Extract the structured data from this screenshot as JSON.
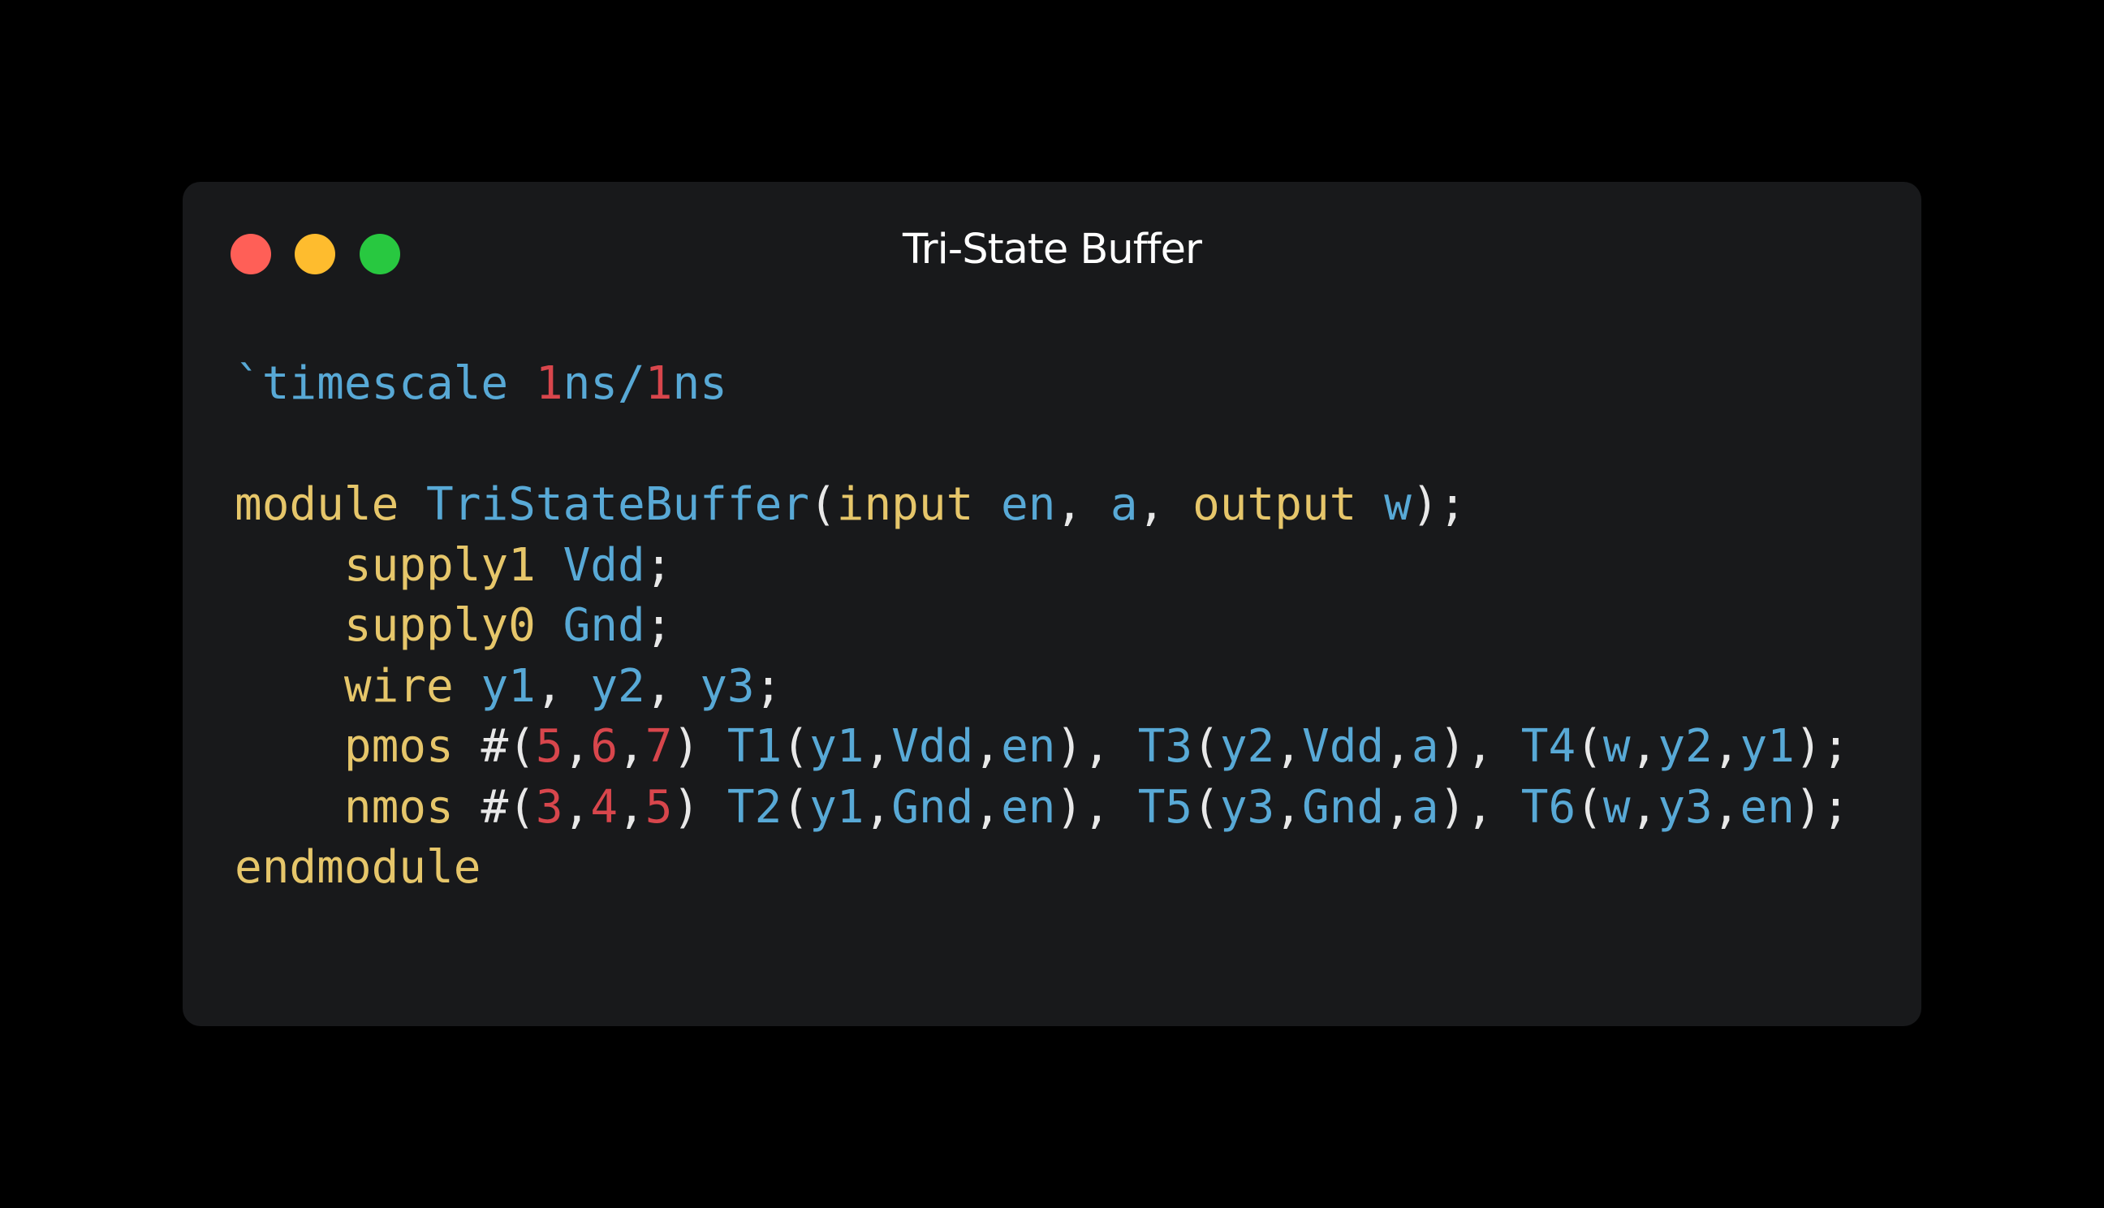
{
  "window": {
    "title": "Tri-State Buffer",
    "buttons": {
      "close_color": "#ff5f57",
      "minimize_color": "#febc2e",
      "maximize_color": "#28c840"
    }
  },
  "colors": {
    "keyword": "#e6c66a",
    "identifier": "#58a9d6",
    "number": "#d8464c",
    "punctuation": "#e8e8e8",
    "background": "#18191b"
  },
  "code": {
    "lines": [
      [
        {
          "t": "`timescale ",
          "c": "id"
        },
        {
          "t": "1",
          "c": "num"
        },
        {
          "t": "ns/",
          "c": "id"
        },
        {
          "t": "1",
          "c": "num"
        },
        {
          "t": "ns",
          "c": "id"
        }
      ],
      [],
      [
        {
          "t": "module ",
          "c": "kw"
        },
        {
          "t": "TriStateBuffer",
          "c": "id"
        },
        {
          "t": "(",
          "c": "p"
        },
        {
          "t": "input ",
          "c": "kw"
        },
        {
          "t": "en",
          "c": "id"
        },
        {
          "t": ", ",
          "c": "p"
        },
        {
          "t": "a",
          "c": "id"
        },
        {
          "t": ", ",
          "c": "p"
        },
        {
          "t": "output ",
          "c": "kw"
        },
        {
          "t": "w",
          "c": "id"
        },
        {
          "t": ");",
          "c": "p"
        }
      ],
      [
        {
          "t": "    ",
          "c": "p"
        },
        {
          "t": "supply1 ",
          "c": "kw"
        },
        {
          "t": "Vdd",
          "c": "id"
        },
        {
          "t": ";",
          "c": "p"
        }
      ],
      [
        {
          "t": "    ",
          "c": "p"
        },
        {
          "t": "supply0 ",
          "c": "kw"
        },
        {
          "t": "Gnd",
          "c": "id"
        },
        {
          "t": ";",
          "c": "p"
        }
      ],
      [
        {
          "t": "    ",
          "c": "p"
        },
        {
          "t": "wire ",
          "c": "kw"
        },
        {
          "t": "y1",
          "c": "id"
        },
        {
          "t": ", ",
          "c": "p"
        },
        {
          "t": "y2",
          "c": "id"
        },
        {
          "t": ", ",
          "c": "p"
        },
        {
          "t": "y3",
          "c": "id"
        },
        {
          "t": ";",
          "c": "p"
        }
      ],
      [
        {
          "t": "    ",
          "c": "p"
        },
        {
          "t": "pmos ",
          "c": "kw"
        },
        {
          "t": "#(",
          "c": "p"
        },
        {
          "t": "5",
          "c": "num"
        },
        {
          "t": ",",
          "c": "p"
        },
        {
          "t": "6",
          "c": "num"
        },
        {
          "t": ",",
          "c": "p"
        },
        {
          "t": "7",
          "c": "num"
        },
        {
          "t": ") ",
          "c": "p"
        },
        {
          "t": "T1",
          "c": "id"
        },
        {
          "t": "(",
          "c": "p"
        },
        {
          "t": "y1",
          "c": "id"
        },
        {
          "t": ",",
          "c": "p"
        },
        {
          "t": "Vdd",
          "c": "id"
        },
        {
          "t": ",",
          "c": "p"
        },
        {
          "t": "en",
          "c": "id"
        },
        {
          "t": "), ",
          "c": "p"
        },
        {
          "t": "T3",
          "c": "id"
        },
        {
          "t": "(",
          "c": "p"
        },
        {
          "t": "y2",
          "c": "id"
        },
        {
          "t": ",",
          "c": "p"
        },
        {
          "t": "Vdd",
          "c": "id"
        },
        {
          "t": ",",
          "c": "p"
        },
        {
          "t": "a",
          "c": "id"
        },
        {
          "t": "), ",
          "c": "p"
        },
        {
          "t": "T4",
          "c": "id"
        },
        {
          "t": "(",
          "c": "p"
        },
        {
          "t": "w",
          "c": "id"
        },
        {
          "t": ",",
          "c": "p"
        },
        {
          "t": "y2",
          "c": "id"
        },
        {
          "t": ",",
          "c": "p"
        },
        {
          "t": "y1",
          "c": "id"
        },
        {
          "t": ");",
          "c": "p"
        }
      ],
      [
        {
          "t": "    ",
          "c": "p"
        },
        {
          "t": "nmos ",
          "c": "kw"
        },
        {
          "t": "#(",
          "c": "p"
        },
        {
          "t": "3",
          "c": "num"
        },
        {
          "t": ",",
          "c": "p"
        },
        {
          "t": "4",
          "c": "num"
        },
        {
          "t": ",",
          "c": "p"
        },
        {
          "t": "5",
          "c": "num"
        },
        {
          "t": ") ",
          "c": "p"
        },
        {
          "t": "T2",
          "c": "id"
        },
        {
          "t": "(",
          "c": "p"
        },
        {
          "t": "y1",
          "c": "id"
        },
        {
          "t": ",",
          "c": "p"
        },
        {
          "t": "Gnd",
          "c": "id"
        },
        {
          "t": ",",
          "c": "p"
        },
        {
          "t": "en",
          "c": "id"
        },
        {
          "t": "), ",
          "c": "p"
        },
        {
          "t": "T5",
          "c": "id"
        },
        {
          "t": "(",
          "c": "p"
        },
        {
          "t": "y3",
          "c": "id"
        },
        {
          "t": ",",
          "c": "p"
        },
        {
          "t": "Gnd",
          "c": "id"
        },
        {
          "t": ",",
          "c": "p"
        },
        {
          "t": "a",
          "c": "id"
        },
        {
          "t": "), ",
          "c": "p"
        },
        {
          "t": "T6",
          "c": "id"
        },
        {
          "t": "(",
          "c": "p"
        },
        {
          "t": "w",
          "c": "id"
        },
        {
          "t": ",",
          "c": "p"
        },
        {
          "t": "y3",
          "c": "id"
        },
        {
          "t": ",",
          "c": "p"
        },
        {
          "t": "en",
          "c": "id"
        },
        {
          "t": ");",
          "c": "p"
        }
      ],
      [
        {
          "t": "endmodule",
          "c": "kw"
        }
      ]
    ]
  }
}
